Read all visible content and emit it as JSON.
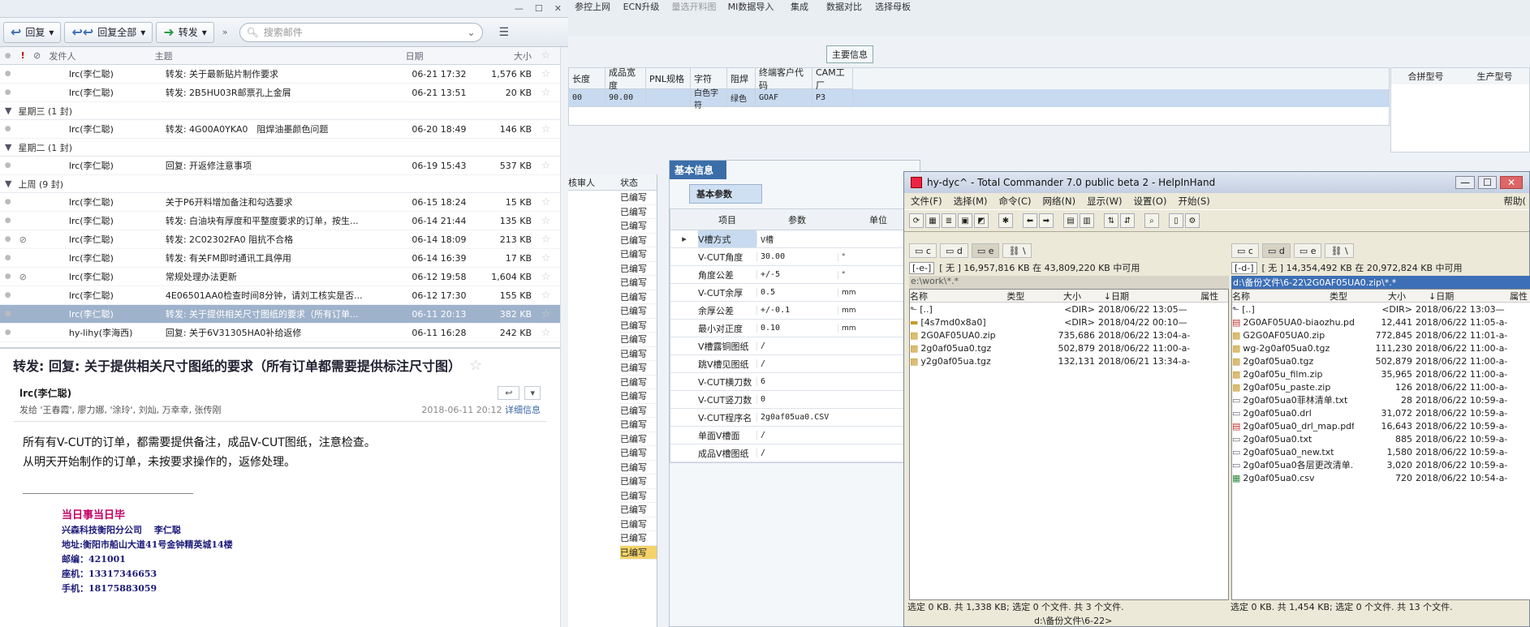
{
  "mail": {
    "toolbar": {
      "reply": "回复",
      "reply_all": "回复全部",
      "forward": "转发",
      "search_placeholder": "搜索邮件"
    },
    "columns": {
      "from": "发件人",
      "subject": "主题",
      "date": "日期",
      "size": "大小"
    },
    "rows": [
      {
        "kind": "mail",
        "from": "lrc(李仁聪)",
        "subject": "转发: 关于最新贴片制作要求",
        "date": "06-21 17:32",
        "size": "1,576 KB",
        "clip": false
      },
      {
        "kind": "mail",
        "from": "lrc(李仁聪)",
        "subject": "转发: 2B5HU03R邮票孔上金屑",
        "date": "06-21 13:51",
        "size": "20 KB",
        "clip": false
      },
      {
        "kind": "group",
        "label": "星期三 (1 封)"
      },
      {
        "kind": "mail",
        "from": "lrc(李仁聪)",
        "subject": "转发: 4G00A0YKA0　阻焊油墨颜色问题",
        "date": "06-20 18:49",
        "size": "146 KB",
        "clip": false
      },
      {
        "kind": "group",
        "label": "星期二 (1 封)"
      },
      {
        "kind": "mail",
        "from": "lrc(李仁聪)",
        "subject": "回复: 开返修注意事项",
        "date": "06-19 15:43",
        "size": "537 KB",
        "clip": false
      },
      {
        "kind": "group",
        "label": "上周 (9 封)"
      },
      {
        "kind": "mail",
        "from": "lrc(李仁聪)",
        "subject": "关于P6开料增加备注和勾选要求",
        "date": "06-15 18:24",
        "size": "15 KB",
        "clip": false
      },
      {
        "kind": "mail",
        "from": "lrc(李仁聪)",
        "subject": "转发: 白油块有厚度和平整度要求的订单，按生...",
        "date": "06-14 21:44",
        "size": "135 KB",
        "clip": false
      },
      {
        "kind": "mail",
        "from": "lrc(李仁聪)",
        "subject": "转发: 2C02302FA0  阻抗不合格",
        "date": "06-14 18:09",
        "size": "213 KB",
        "clip": true
      },
      {
        "kind": "mail",
        "from": "lrc(李仁聪)",
        "subject": "转发: 有关FM即时通讯工具停用",
        "date": "06-14 16:39",
        "size": "17 KB",
        "clip": false
      },
      {
        "kind": "mail",
        "from": "lrc(李仁聪)",
        "subject": "常规处理办法更新",
        "date": "06-12 19:58",
        "size": "1,604 KB",
        "clip": true
      },
      {
        "kind": "mail",
        "from": "lrc(李仁聪)",
        "subject": "4E06501AA0检查时间8分钟，请刘工核实是否...",
        "date": "06-12 17:30",
        "size": "155 KB",
        "clip": false
      },
      {
        "kind": "mail",
        "from": "lrc(李仁聪)",
        "subject": "转发: 关于提供相关尺寸图纸的要求（所有订单...",
        "date": "06-11 20:13",
        "size": "382 KB",
        "clip": false,
        "selected": true
      },
      {
        "kind": "mail",
        "from": "hy-lihy(李海西)",
        "subject": "回复: 关于6V31305HA0补给返修",
        "date": "06-11 16:28",
        "size": "242 KB",
        "clip": false
      }
    ],
    "preview": {
      "title": "转发: 回复: 关于提供相关尺寸图纸的要求（所有订单都需要提供标注尺寸图）",
      "sender": "lrc(李仁聪)",
      "recipients": "发给 '王春霞', 廖力娜, '涂玲', 刘灿, 万幸幸, 张传刚",
      "datetime": "2018-06-11 20:12",
      "details_link": "详细信息",
      "body1": "所有有V-CUT的订单，都需要提供备注，成品V-CUT图纸，注意检查。",
      "body2": "从明天开始制作的订单，未按要求操作的，返修处理。",
      "sig": [
        "当日事当日毕",
        "兴森科技衡阳分公司　 李仁聪",
        "地址:衡阳市船山大道41号金钟精英城14楼",
        "邮编：421001",
        "座机：13317346653",
        "手机：18175883059"
      ]
    }
  },
  "erp": {
    "menu": [
      "参控上网",
      "ECN升级",
      "量选开料图",
      "MI数据导入",
      "集成",
      "数据对比",
      "选择母板"
    ],
    "main_info": "主要信息",
    "top_headers": [
      "长度",
      "成品宽度",
      "PNL规格",
      "字符",
      "阻焊",
      "终端客户代码",
      "CAM工厂"
    ],
    "top_values": [
      "00",
      "90.00",
      "",
      "白色字符",
      "绿色",
      "GOAF",
      "P3"
    ],
    "right_headers": [
      "合拼型号",
      "生产型号"
    ],
    "status_headers": [
      "核审人",
      "状态"
    ],
    "status_values": [
      "已编写",
      "已编写",
      "已编写",
      "已编写",
      "已编写",
      "已编写",
      "已编写",
      "已编写",
      "已编写",
      "已编写",
      "已编写",
      "已编写",
      "已编写",
      "已编写",
      "已编写",
      "已编写",
      "已编写",
      "已编写",
      "已编写",
      "已编写",
      "已编写",
      "已编写",
      "已编写",
      "已编写",
      "已编写",
      "已编写"
    ],
    "basic_info": "基本信息",
    "basic_params": "基本参数",
    "param_headers": [
      "项目",
      "参数",
      "单位"
    ],
    "params": [
      [
        "V槽方式",
        "V槽",
        ""
      ],
      [
        "V-CUT角度",
        "30.00",
        "°"
      ],
      [
        "角度公差",
        "+/-5",
        "°"
      ],
      [
        "V-CUT余厚",
        "0.5",
        "mm"
      ],
      [
        "余厚公差",
        "+/-0.1",
        "mm"
      ],
      [
        "最小对正度",
        "0.10",
        "mm"
      ],
      [
        "V槽露铜图纸",
        "/",
        ""
      ],
      [
        "跳V槽见图纸",
        "/",
        ""
      ],
      [
        "V-CUT横刀数",
        "6",
        ""
      ],
      [
        "V-CUT竖刀数",
        "0",
        ""
      ],
      [
        "V-CUT程序名",
        "2g0af05ua0.CSV",
        ""
      ],
      [
        "单面V槽面",
        "/",
        ""
      ],
      [
        "成品V槽图纸",
        "/",
        ""
      ]
    ]
  },
  "tc": {
    "title": "hy-dyc^ - Total Commander 7.0 public beta 2 - HelpInHand",
    "menu": [
      "文件(F)",
      "选择(M)",
      "命令(C)",
      "网络(N)",
      "显示(W)",
      "设置(O)",
      "开始(S)"
    ],
    "help": "帮助(",
    "left": {
      "drive": "[-e-]",
      "free": "[ 无 ]  16,957,816 KB 在 43,809,220 KB 中可用",
      "path": "e:\\work\\*.*",
      "headers": [
        "名称",
        "类型",
        "大小",
        "↓日期",
        "属性"
      ],
      "files": [
        {
          "name": "[..]",
          "size": "<DIR>",
          "date": "2018/06/22 13:05—",
          "t": "up"
        },
        {
          "name": "[4s7md0x8a0]",
          "size": "<DIR>",
          "date": "2018/04/22 00:10—",
          "t": "dir"
        },
        {
          "name": "2G0AF05UA0.zip",
          "size": "735,686",
          "date": "2018/06/22 13:04-a-",
          "t": "arc"
        },
        {
          "name": "2g0af05ua0.tgz",
          "size": "502,879",
          "date": "2018/06/22 11:00-a-",
          "t": "arc"
        },
        {
          "name": "y2g0af05ua.tgz",
          "size": "132,131",
          "date": "2018/06/21 13:34-a-",
          "t": "arc"
        }
      ],
      "status": "选定 0 KB. 共 1,338 KB; 选定 0 个文件. 共 3 个文件."
    },
    "right": {
      "drive": "[-d-]",
      "free": "[ 无 ]  14,354,492 KB 在 20,972,824 KB 中可用",
      "path": "d:\\备份文件\\6-22\\2G0AF05UA0.zip\\*.*",
      "headers": [
        "名称",
        "类型",
        "大小",
        "↓日期",
        "属性"
      ],
      "files": [
        {
          "name": "[..]",
          "size": "<DIR>",
          "date": "2018/06/22 13:03—",
          "t": "up"
        },
        {
          "name": "2G0AF05UA0-biaozhu.pdf",
          "size": "12,441",
          "date": "2018/06/22 11:05-a-",
          "t": "pdf"
        },
        {
          "name": "G2G0AF05UA0.zip",
          "size": "772,845",
          "date": "2018/06/22 11:01-a-",
          "t": "arc"
        },
        {
          "name": "wg-2g0af05ua0.tgz",
          "size": "111,230",
          "date": "2018/06/22 11:00-a-",
          "t": "arc"
        },
        {
          "name": "2g0af05ua0.tgz",
          "size": "502,879",
          "date": "2018/06/22 11:00-a-",
          "t": "arc"
        },
        {
          "name": "2g0af05u_film.zip",
          "size": "35,965",
          "date": "2018/06/22 11:00-a-",
          "t": "arc"
        },
        {
          "name": "2g0af05u_paste.zip",
          "size": "126",
          "date": "2018/06/22 11:00-a-",
          "t": "arc"
        },
        {
          "name": "2g0af05ua0菲林清单.txt",
          "size": "28",
          "date": "2018/06/22 10:59-a-",
          "t": "txt"
        },
        {
          "name": "2g0af05ua0.drl",
          "size": "31,072",
          "date": "2018/06/22 10:59-a-",
          "t": "drl"
        },
        {
          "name": "2g0af05ua0_drl_map.pdf",
          "size": "16,643",
          "date": "2018/06/22 10:59-a-",
          "t": "pdf"
        },
        {
          "name": "2g0af05ua0.txt",
          "size": "885",
          "date": "2018/06/22 10:59-a-",
          "t": "txt"
        },
        {
          "name": "2g0af05ua0_new.txt",
          "size": "1,580",
          "date": "2018/06/22 10:59-a-",
          "t": "txt"
        },
        {
          "name": "2g0af05ua0各层更改清单.txt",
          "size": "3,020",
          "date": "2018/06/22 10:59-a-",
          "t": "txt"
        },
        {
          "name": "2g0af05ua0.csv",
          "size": "720",
          "date": "2018/06/22 10:54-a-",
          "t": "csv"
        }
      ],
      "status": "选定 0 KB. 共 1,454 KB; 选定 0 个文件. 共 13 个文件."
    },
    "cmdline": "d:\\备份文件\\6-22>"
  }
}
